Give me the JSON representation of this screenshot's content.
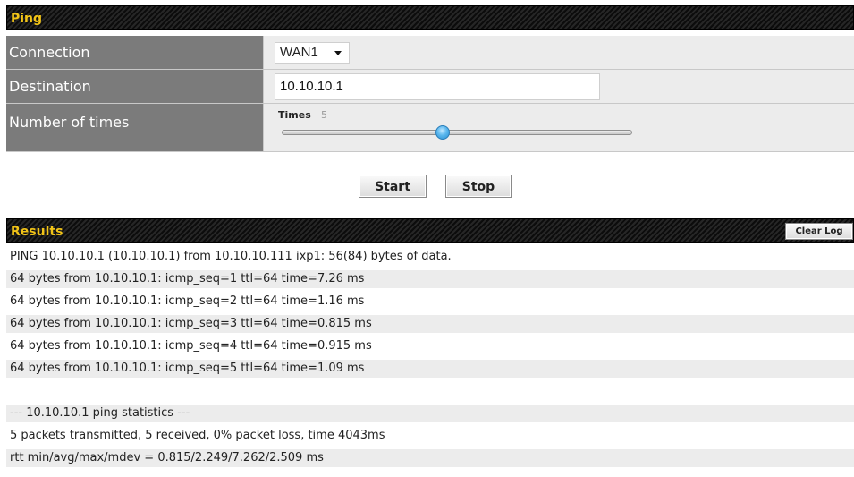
{
  "ping": {
    "title": "Ping",
    "connection": {
      "label": "Connection",
      "value": "WAN1"
    },
    "destination": {
      "label": "Destination",
      "value": "10.10.10.1"
    },
    "times": {
      "label": "Number of times",
      "slider_label": "Times",
      "value": "5",
      "level": 0.46
    }
  },
  "buttons": {
    "start": "Start",
    "stop": "Stop"
  },
  "results": {
    "title": "Results",
    "clear_log": "Clear Log",
    "lines": [
      "PING 10.10.10.1 (10.10.10.1) from 10.10.10.111 ixp1: 56(84) bytes of data.",
      "64 bytes from 10.10.10.1: icmp_seq=1 ttl=64 time=7.26 ms",
      "64 bytes from 10.10.10.1: icmp_seq=2 ttl=64 time=1.16 ms",
      "64 bytes from 10.10.10.1: icmp_seq=3 ttl=64 time=0.815 ms",
      "64 bytes from 10.10.10.1: icmp_seq=4 ttl=64 time=0.915 ms",
      "64 bytes from 10.10.10.1: icmp_seq=5 ttl=64 time=1.09 ms",
      "",
      "--- 10.10.10.1 ping statistics ---",
      "5 packets transmitted, 5 received, 0% packet loss, time 4043ms",
      "rtt min/avg/max/mdev = 0.815/2.249/7.262/2.509 ms"
    ]
  },
  "colors": {
    "header_title": "#f2c417",
    "label_bg": "#7b7b7b",
    "row_bg": "#ececec"
  }
}
